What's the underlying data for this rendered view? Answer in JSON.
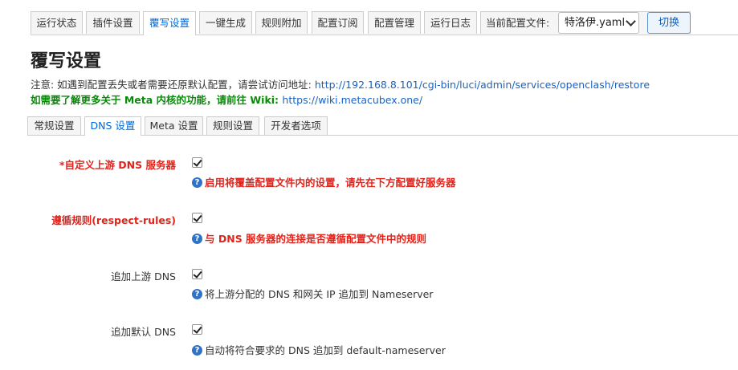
{
  "top_tabs": [
    {
      "label": "运行状态"
    },
    {
      "label": "插件设置"
    },
    {
      "label": "覆写设置"
    },
    {
      "label": "一键生成"
    },
    {
      "label": "规则附加"
    },
    {
      "label": "配置订阅"
    },
    {
      "label": "配置管理"
    },
    {
      "label": "运行日志"
    }
  ],
  "config_file": {
    "label": "当前配置文件:",
    "selected": "特洛伊.yaml",
    "switch_label": "切换"
  },
  "page": {
    "title": "覆写设置",
    "notice_prefix": "注意: 如遇到配置丢失或者需要还原默认配置，请尝试访问地址: ",
    "notice_link": "http://192.168.8.101/cgi-bin/luci/admin/services/openclash/restore",
    "meta_notice_prefix": "如需要了解更多关于 Meta 内核的功能，请前往 Wiki: ",
    "meta_notice_link": "https://wiki.metacubex.one/"
  },
  "sub_tabs": [
    {
      "label": "常规设置"
    },
    {
      "label": "DNS 设置"
    },
    {
      "label": "Meta 设置"
    },
    {
      "label": "规则设置"
    },
    {
      "label": "开发者选项"
    }
  ],
  "options": [
    {
      "label": "*自定义上游 DNS 服务器",
      "checked": true,
      "help": "启用将覆盖配置文件内的设置，请先在下方配置好服务器"
    },
    {
      "label": "遵循规则(respect-rules)",
      "checked": true,
      "help": "与 DNS 服务器的连接是否遵循配置文件中的规则"
    },
    {
      "label": "追加上游 DNS",
      "checked": true,
      "help": "将上游分配的 DNS 和网关 IP 追加到 Nameserver"
    },
    {
      "label": "追加默认 DNS",
      "checked": true,
      "help": "自动将符合要求的 DNS 追加到 default-nameserver"
    }
  ],
  "help_icon_glyph": "?",
  "colors": {
    "accent": "#0069d6",
    "warning_red": "#e0241c",
    "meta_green": "#0a8a0a",
    "link_blue": "#1a62c4",
    "help_icon_blue": "#2f72c6"
  }
}
